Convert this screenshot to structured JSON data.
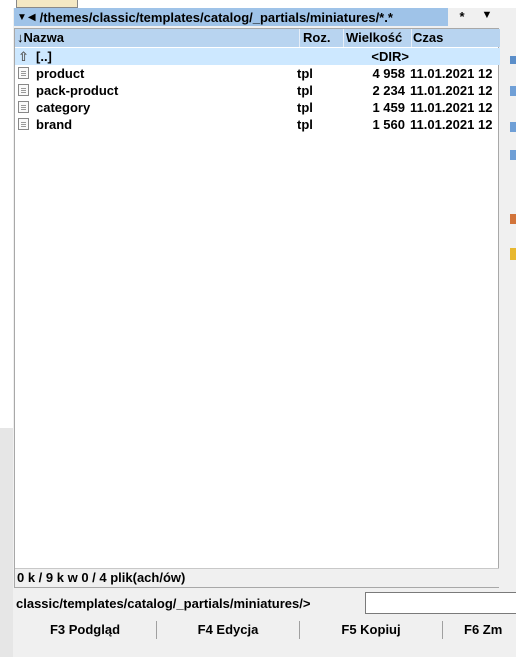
{
  "path_bar": {
    "arrows": "▼◀",
    "path": "/themes/classic/templates/catalog/_partials/miniatures/*.*"
  },
  "star_label": "*",
  "dropdown_icon": "chevron-down-icon",
  "columns": {
    "name": "Nazwa",
    "ext": "Roz.",
    "size": "Wielkość",
    "time": "Czas",
    "sort_indicator": "↓"
  },
  "files": [
    {
      "name": "[..]",
      "ext": "",
      "size": "<DIR>",
      "time": "",
      "type": "parent",
      "icon": "up-folder-icon"
    },
    {
      "name": "product",
      "ext": "tpl",
      "size": "4 958",
      "time": "11.01.2021 12",
      "type": "file",
      "icon": "file-icon"
    },
    {
      "name": "pack-product",
      "ext": "tpl",
      "size": "2 234",
      "time": "11.01.2021 12",
      "type": "file",
      "icon": "file-icon"
    },
    {
      "name": "category",
      "ext": "tpl",
      "size": "1 459",
      "time": "11.01.2021 12",
      "type": "file",
      "icon": "file-icon"
    },
    {
      "name": "brand",
      "ext": "tpl",
      "size": "1 560",
      "time": "11.01.2021 12",
      "type": "file",
      "icon": "file-icon"
    }
  ],
  "status": "0 k / 9 k w 0 / 4 plik(ach/ów)",
  "command_line": {
    "prompt": "classic/templates/catalog/_partials/miniatures/>",
    "value": ""
  },
  "function_keys": [
    {
      "label": "F3 Podgląd"
    },
    {
      "label": "F4 Edycja"
    },
    {
      "label": "F5 Kopiuj"
    },
    {
      "label": "F6 Zm"
    }
  ],
  "colors": {
    "path_bar": "#9fc3e8",
    "header": "#b8d4f0",
    "selected_row": "#cde8ff"
  }
}
